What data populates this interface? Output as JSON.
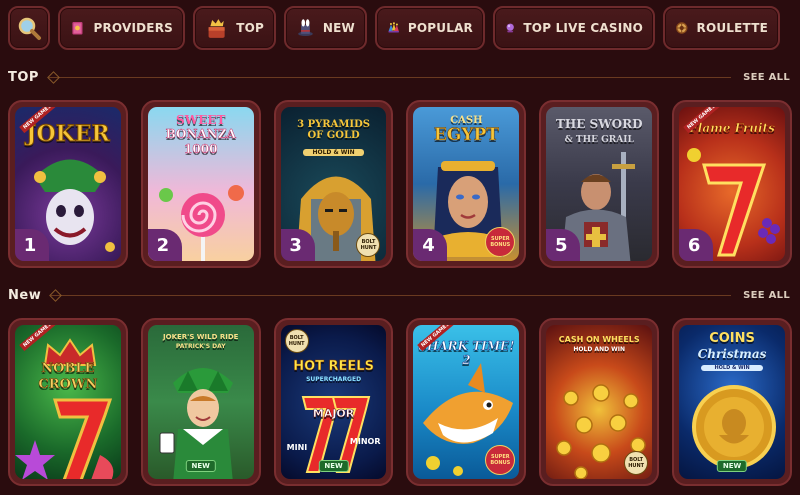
{
  "nav": {
    "items": [
      {
        "key": "search",
        "label": "",
        "icon": "search-icon"
      },
      {
        "key": "providers",
        "label": "PROVIDERS",
        "icon": "book-icon"
      },
      {
        "key": "top",
        "label": "TOP",
        "icon": "crown-box-icon"
      },
      {
        "key": "new",
        "label": "NEW",
        "icon": "magic-hat-icon"
      },
      {
        "key": "popular",
        "label": "POPULAR",
        "icon": "jester-hat-icon"
      },
      {
        "key": "live",
        "label": "TOP LIVE CASINO",
        "icon": "crystal-ball-icon"
      },
      {
        "key": "roulette",
        "label": "ROULETTE",
        "icon": "roulette-wheel-icon"
      }
    ]
  },
  "sections": [
    {
      "title": "TOP",
      "see_all": "SEE ALL",
      "games": [
        {
          "title1": "JOKER",
          "title2": "",
          "rank": "1",
          "ribbon": "NEW GAMES"
        },
        {
          "title1": "SWEET",
          "title2": "BONANZA 1000",
          "rank": "2",
          "ribbon": ""
        },
        {
          "title1": "3 PYRAMIDS OF GOLD",
          "title2": "HOLD & WIN",
          "rank": "3",
          "ribbon": "",
          "provider": "BOLT HUNT"
        },
        {
          "title1": "CASH",
          "title2": "EGYPT",
          "rank": "4",
          "ribbon": "",
          "provider": "SUPER BONUS"
        },
        {
          "title1": "THE SWORD",
          "title2": "& THE GRAIL",
          "rank": "5",
          "ribbon": ""
        },
        {
          "title1": "Flame Fruits",
          "title2": "",
          "rank": "6",
          "ribbon": "NEW GAMES"
        }
      ]
    },
    {
      "title": "New",
      "see_all": "SEE ALL",
      "games": [
        {
          "title1": "NOBLE",
          "title2": "CROWN",
          "ribbon": "NEW GAMES",
          "badge": ""
        },
        {
          "title1": "JOKER'S WILD RIDE",
          "title2": "PATRICK'S DAY",
          "ribbon": "",
          "badge": "NEW"
        },
        {
          "title1": "HOT REELS",
          "title2": "SUPERCHARGED",
          "ribbon": "",
          "badge": "NEW",
          "provider": "BOLT HUNT",
          "sub1": "MAJOR",
          "sub2": "MINI",
          "sub3": "MINOR"
        },
        {
          "title1": "SHARK TIME! 2",
          "title2": "",
          "ribbon": "NEW GAMES",
          "badge": "",
          "provider": "SUPER BONUS"
        },
        {
          "title1": "CASH ON WHEELS",
          "title2": "HOLD AND WIN",
          "ribbon": "",
          "badge": "",
          "provider": "BOLT HUNT"
        },
        {
          "title1": "COINS",
          "title2": "Christmas",
          "title3": "HOLD & WIN",
          "ribbon": "",
          "badge": "NEW"
        }
      ]
    }
  ]
}
